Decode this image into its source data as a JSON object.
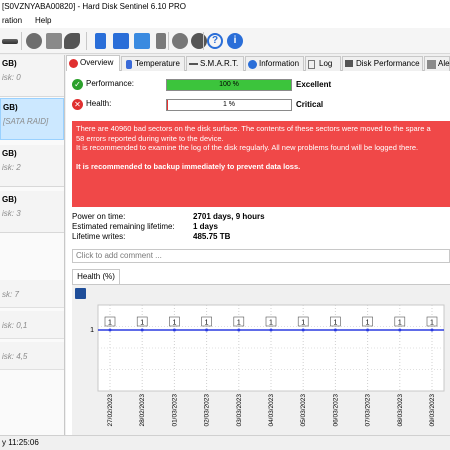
{
  "window": {
    "title": "[S0VZNYABA00820] - Hard Disk Sentinel 6.10 PRO"
  },
  "menu": {
    "items": [
      "ration",
      "Help"
    ]
  },
  "disks": [
    {
      "size": "GB)",
      "desc": "isk: 0"
    },
    {
      "size": "GB)",
      "desc": "[SATA RAID]",
      "selected": true
    },
    {
      "size": "GB)",
      "desc": "isk: 2"
    },
    {
      "size": "GB)",
      "desc": "isk: 3"
    }
  ],
  "disks_lower": [
    "sk: 7",
    "isk: 0,1",
    "isk: 4,5"
  ],
  "tabs": [
    "Overview",
    "Temperature",
    "S.M.A.R.T.",
    "Information",
    "Log",
    "Disk Performance",
    "Ale"
  ],
  "performance": {
    "label": "Performance:",
    "value_text": "100 %",
    "value": 100,
    "rating": "Excellent",
    "color": "#3cc43c"
  },
  "health": {
    "label": "Health:",
    "value_text": "1 %",
    "value": 1,
    "rating": "Critical",
    "color": "#e83030"
  },
  "alert": {
    "lines": [
      "There are 40960 bad sectors on the disk surface. The contents of these sectors were moved to the spare a",
      "58 errors reported during write to the device.",
      "It is recommended to examine the log of the disk regularly. All new problems found will be logged there."
    ],
    "emphasis": "It is recommended to backup immediately to prevent data loss.",
    "color": "#f04848"
  },
  "stats": [
    {
      "key": "Power on time:",
      "value": "2701 days, 9 hours"
    },
    {
      "key": "Estimated remaining lifetime:",
      "value": "1 days"
    },
    {
      "key": "Lifetime writes:",
      "value": "485.75 TB"
    }
  ],
  "comment_placeholder": "Click to add comment ...",
  "health_tab": "Health (%)",
  "chart_data": {
    "type": "line",
    "title": "",
    "xlabel": "",
    "ylabel": "",
    "x": [
      "27/02/2023",
      "28/02/2023",
      "01/03/2023",
      "02/03/2023",
      "03/03/2023",
      "04/03/2023",
      "05/03/2023",
      "06/03/2023",
      "07/03/2023",
      "08/03/2023",
      "09/03/2023"
    ],
    "values": [
      1,
      1,
      1,
      1,
      1,
      1,
      1,
      1,
      1,
      1,
      1
    ],
    "data_labels": [
      "1",
      "1",
      "1",
      "1",
      "1",
      "1",
      "1",
      "1",
      "1",
      "1",
      "1"
    ],
    "y_tick": "1",
    "grid": true,
    "line_color": "#2b3be0"
  },
  "status": {
    "text": "y 11:25:06"
  }
}
